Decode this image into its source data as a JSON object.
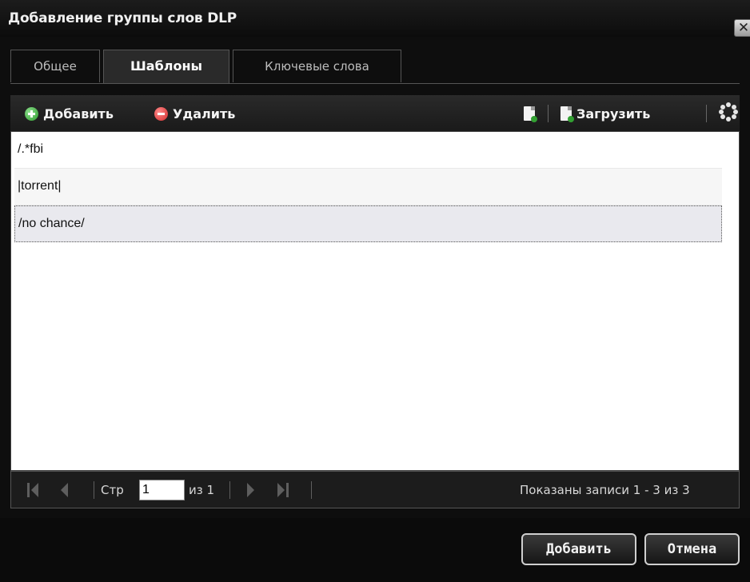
{
  "dialog": {
    "title": "Добавление группы слов DLP",
    "close_symbol": "✕"
  },
  "tabs": [
    {
      "label": "Общее",
      "active": false
    },
    {
      "label": "Шаблоны",
      "active": true
    },
    {
      "label": "Ключевые слова",
      "active": false
    }
  ],
  "toolbar": {
    "add_label": "Добавить",
    "delete_label": "Удалить",
    "upload_label": "Загрузить",
    "icons": [
      "add-icon",
      "delete-icon",
      "export-icon",
      "upload-icon",
      "refresh-icon"
    ]
  },
  "rows": [
    "/.*fbi",
    "|torrent|",
    "/no chance/"
  ],
  "pager": {
    "page_label": "Стр",
    "page_value": "1",
    "of_label": "из 1",
    "status": "Показаны записи 1 - 3 из 3"
  },
  "buttons": {
    "add": "Добавить",
    "cancel": "Отмена"
  },
  "colors": {
    "background": "#0e0e0e",
    "grid": "#ffffff",
    "selected_row": "#e9e9ee"
  }
}
